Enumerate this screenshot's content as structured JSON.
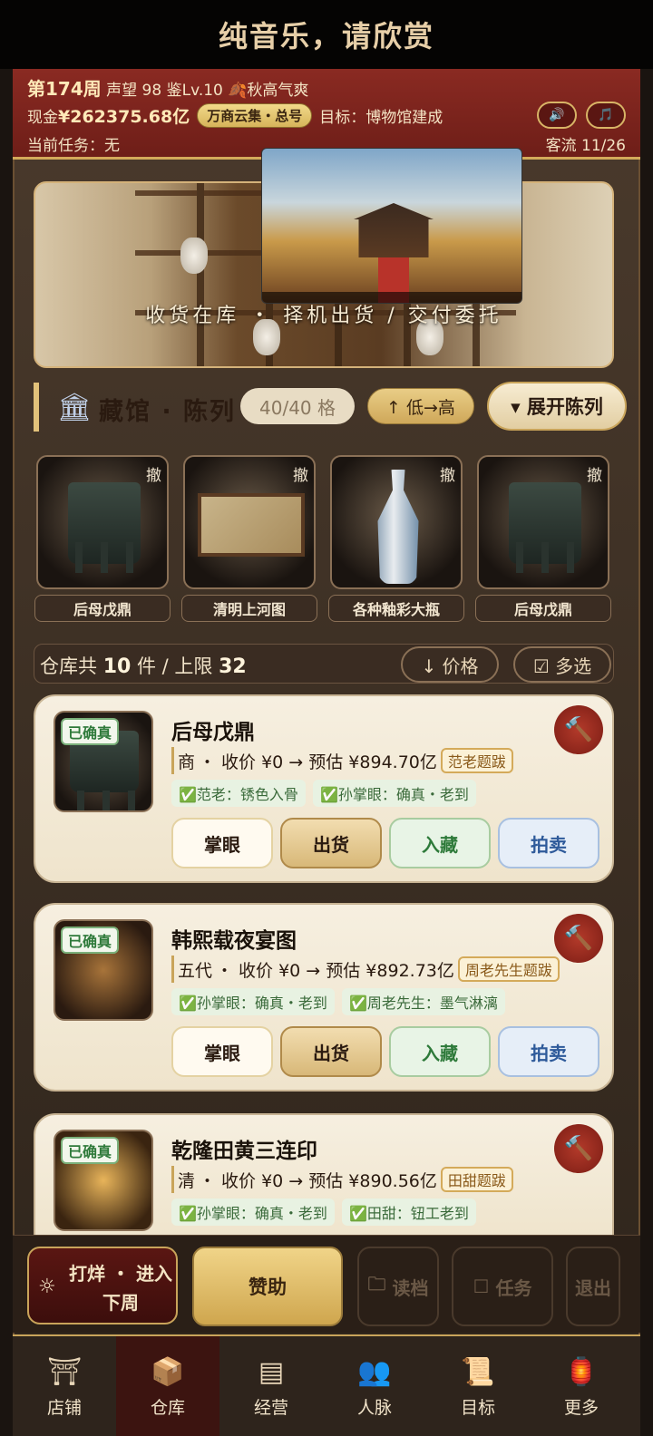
{
  "topbar": {
    "title": "纯音乐，请欣赏"
  },
  "header": {
    "week": "第174周",
    "reputation": "声望 98",
    "appraise_level": "鉴Lv.10",
    "season": "🍂秋高气爽",
    "cash_label": "现金",
    "cash_value": "¥262375.68亿",
    "shop_name": "万商云集・总号",
    "goal": "目标：博物馆建成",
    "task": "当前任务：无",
    "flow": "客流 11/26",
    "sound_icon": "🔊",
    "music_icon": "🎵"
  },
  "banner": {
    "caption": "收货在库 ・ 择机出货 / 交付委托"
  },
  "museum": {
    "icon": "🏛",
    "title": "藏馆 · 陈列",
    "count": "40/40 格",
    "sort": "↑ 低→高",
    "expand": "▾ 展开陈列",
    "items": [
      {
        "name": "后母戊鼎",
        "remove": "撤"
      },
      {
        "name": "清明上河图",
        "remove": "撤"
      },
      {
        "name": "各种釉彩大瓶",
        "remove": "撤"
      },
      {
        "name": "后母戊鼎",
        "remove": "撤"
      }
    ]
  },
  "warehouse": {
    "prefix": "仓库共",
    "count": "10",
    "mid": "件 / 上限",
    "limit": "32",
    "price_btn": "↓ 价格",
    "multi_btn": "☑ 多选"
  },
  "cards": [
    {
      "status": "已确真",
      "name": "后母戊鼎",
      "dynasty": "商",
      "price_text": "・ 收价 ¥0 → 预估 ¥894.70亿",
      "endorsement": "范老题跋",
      "tags": [
        "✅范老：锈色入骨",
        "✅孙掌眼：确真・老到"
      ],
      "actions": [
        "掌眼",
        "出货",
        "入藏",
        "拍卖"
      ]
    },
    {
      "status": "已确真",
      "name": "韩熙载夜宴图",
      "dynasty": "五代",
      "price_text": "・ 收价 ¥0 → 预估 ¥892.73亿",
      "endorsement": "周老先生题跋",
      "tags": [
        "✅孙掌眼：确真・老到",
        "✅周老先生：墨气淋漓"
      ],
      "actions": [
        "掌眼",
        "出货",
        "入藏",
        "拍卖"
      ]
    },
    {
      "status": "已确真",
      "name": "乾隆田黄三连印",
      "dynasty": "清",
      "price_text": "・ 收价 ¥0 → 预估 ¥890.56亿",
      "endorsement": "田甜题跋",
      "tags": [
        "✅孙掌眼：确真・老到",
        "✅田甜：钮工老到"
      ],
      "actions": []
    }
  ],
  "bottom": {
    "main_line1": "打烊 ・ 进入",
    "main_line2": "下周",
    "sponsor": "赞助",
    "load": "读档",
    "task": "任务",
    "exit": "退出"
  },
  "tabs": [
    {
      "label": "店铺",
      "icon": "shop-icon"
    },
    {
      "label": "仓库",
      "icon": "warehouse-icon"
    },
    {
      "label": "经营",
      "icon": "ledger-icon"
    },
    {
      "label": "人脉",
      "icon": "people-icon"
    },
    {
      "label": "目标",
      "icon": "scroll-icon"
    },
    {
      "label": "更多",
      "icon": "lantern-icon"
    }
  ],
  "active_tab": "仓库"
}
